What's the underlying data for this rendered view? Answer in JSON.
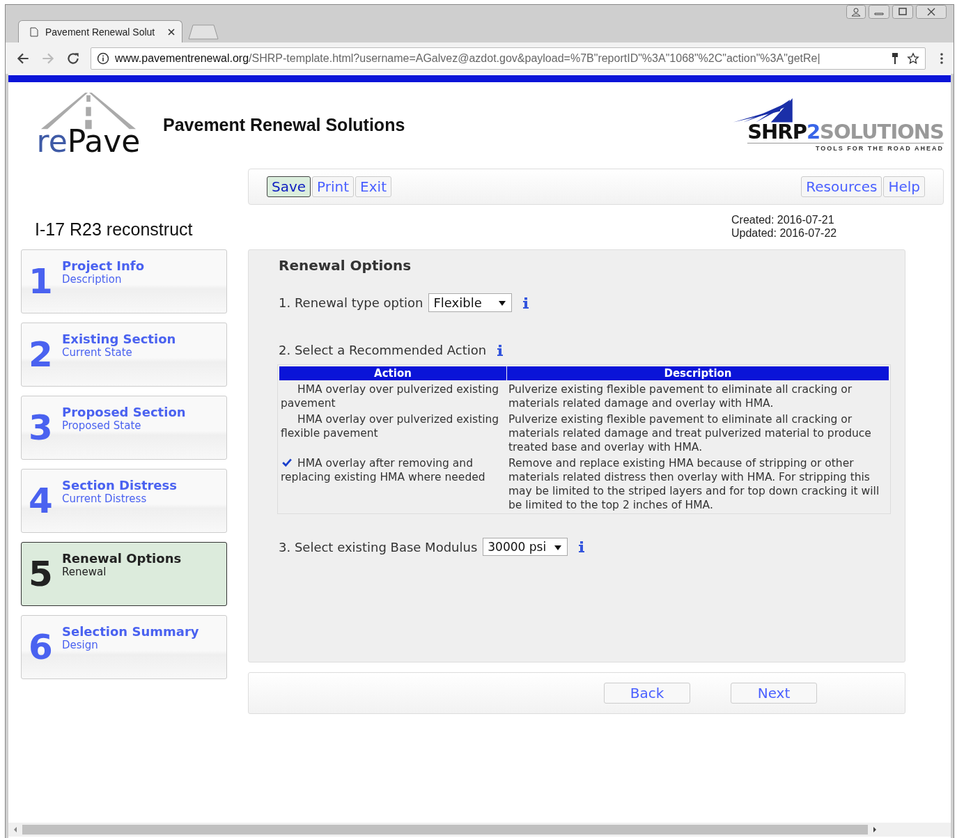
{
  "browser": {
    "tab_title": "Pavement Renewal Solut",
    "url_host": "www.pavementrenewal.org",
    "url_path": "/SHRP-template.html?username=AGalvez@azdot.gov&payload=%7B\"reportID\"%3A\"1068\"%2C\"action\"%3A\"getRe|"
  },
  "header": {
    "logo_re": "re",
    "logo_pave": "Pave",
    "title": "Pavement Renewal Solutions",
    "sponsor_shrp": "SHRP",
    "sponsor_2": "2",
    "sponsor_solutions": "SOLUTIONS",
    "sponsor_tagline": "TOOLS FOR THE ROAD AHEAD"
  },
  "toolbar": {
    "left": [
      {
        "label": "Save",
        "selected": true
      },
      {
        "label": "Print",
        "selected": false
      },
      {
        "label": "Exit",
        "selected": false
      }
    ],
    "right": [
      {
        "label": "Resources",
        "selected": false
      },
      {
        "label": "Help",
        "selected": false
      }
    ]
  },
  "project": {
    "name": "I-17 R23 reconstruct",
    "created_label": "Created:",
    "created": "2016-07-21",
    "updated_label": "Updated:",
    "updated": "2016-07-22"
  },
  "steps": [
    {
      "number": "1",
      "title": "Project Info",
      "subtitle": "Description",
      "selected": false
    },
    {
      "number": "2",
      "title": "Existing Section",
      "subtitle": "Current State",
      "selected": false
    },
    {
      "number": "3",
      "title": "Proposed Section",
      "subtitle": "Proposed State",
      "selected": false
    },
    {
      "number": "4",
      "title": "Section Distress",
      "subtitle": "Current Distress",
      "selected": false
    },
    {
      "number": "5",
      "title": "Renewal Options",
      "subtitle": "Renewal",
      "selected": true
    },
    {
      "number": "6",
      "title": "Selection Summary",
      "subtitle": "Design",
      "selected": false
    }
  ],
  "panel": {
    "title": "Renewal Options",
    "q1": {
      "label": "1. Renewal type option",
      "value": "Flexible"
    },
    "q2": {
      "label": "2. Select a Recommended Action"
    },
    "table": {
      "columns": [
        "Action",
        "Description"
      ],
      "rows": [
        {
          "action": "HMA overlay over pulverized existing pavement",
          "description": "Pulverize existing flexible pavement to eliminate all cracking or materials related damage and overlay with HMA.",
          "selected": false
        },
        {
          "action": "HMA overlay over pulverized existing flexible pavement",
          "description": "Pulverize existing flexible pavement to eliminate all cracking or materials related damage and treat pulverized material to produce treated base and overlay with HMA.",
          "selected": false
        },
        {
          "action": "HMA overlay after removing and replacing existing HMA where needed",
          "description": "Remove and replace existing HMA because of stripping or other materials related distress then overlay with HMA. For stripping this may be limited to the striped layers and for top down cracking it will be limited to the top 2 inches of HMA.",
          "selected": true
        }
      ]
    },
    "q3": {
      "label": "3. Select existing Base Modulus",
      "value": "30000 psi"
    }
  },
  "nav": {
    "back": "Back",
    "next": "Next"
  }
}
